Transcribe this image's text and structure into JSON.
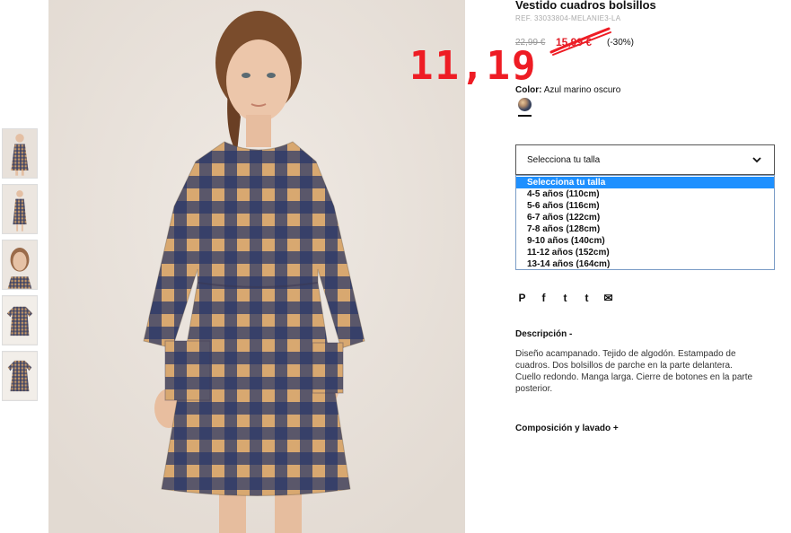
{
  "product": {
    "title": "Vestido cuadros bolsillos",
    "ref": "REF. 33033804-MELANIE3-LA",
    "price_old": "22,99 €",
    "price_sale": "15,99 €",
    "discount": "(-30%)",
    "handwritten_price": "11,19",
    "color_label": "Color:",
    "color_value": "Azul marino oscuro"
  },
  "size_select": {
    "selected": "Selecciona tu talla",
    "options": [
      "Selecciona tu talla",
      "4-5 años (110cm)",
      "5-6 años (116cm)",
      "6-7 años (122cm)",
      "7-8 años (128cm)",
      "9-10 años (140cm)",
      "11-12 años (152cm)",
      "13-14 años (164cm)"
    ]
  },
  "social": {
    "icons": [
      "pinterest-icon",
      "facebook-icon",
      "twitter-icon",
      "tumblr-icon",
      "email-icon"
    ],
    "glyphs": [
      "P",
      "f",
      "t",
      "t",
      "✉"
    ]
  },
  "description": {
    "heading": "Descripción -",
    "text": "Diseño acampanado. Tejido de algodón. Estampado de cuadros. Dos bolsillos de parche en la parte delantera. Cuello redondo. Manga larga. Cierre de botones en la parte posterior."
  },
  "composition": {
    "heading": "Composición y lavado +"
  },
  "colors": {
    "sale": "#e0202a",
    "annotation": "#ee1c24",
    "dropdown_highlight": "#1e90ff",
    "check_tan": "#d8a870",
    "check_navy": "#2a3868"
  }
}
